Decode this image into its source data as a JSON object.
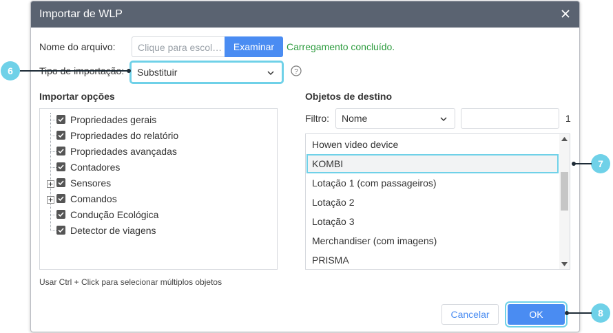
{
  "dialog": {
    "title": "Importar de WLP",
    "file_label": "Nome do arquivo:",
    "file_placeholder": "Clique para escol…",
    "browse_label": "Examinar",
    "status": "Carregamento concluído.",
    "import_type_label": "Tipo de importação:",
    "import_type_value": "Substituir",
    "import_options_title": "Importar opções",
    "options": [
      {
        "label": "Propriedades gerais",
        "checked": true,
        "expandable": false
      },
      {
        "label": "Propriedades do relatório",
        "checked": true,
        "expandable": false
      },
      {
        "label": "Propriedades avançadas",
        "checked": true,
        "expandable": false
      },
      {
        "label": "Contadores",
        "checked": true,
        "expandable": false
      },
      {
        "label": "Sensores",
        "checked": true,
        "expandable": true
      },
      {
        "label": "Comandos",
        "checked": true,
        "expandable": true
      },
      {
        "label": "Condução Ecológica",
        "checked": true,
        "expandable": false
      },
      {
        "label": "Detector de viagens",
        "checked": true,
        "expandable": false
      }
    ],
    "hint": "Usar Ctrl + Click para selecionar múltiplos objetos",
    "targets_title": "Objetos de destino",
    "filter_label": "Filtro:",
    "filter_value": "Nome",
    "filter_count": "1",
    "targets": [
      {
        "label": "Howen video device",
        "selected": false
      },
      {
        "label": "KOMBI",
        "selected": true
      },
      {
        "label": "Lotação 1 (com passageiros)",
        "selected": false
      },
      {
        "label": "Lotação 2",
        "selected": false
      },
      {
        "label": "Lotação 3",
        "selected": false
      },
      {
        "label": "Merchandiser (com imagens)",
        "selected": false
      },
      {
        "label": "PRISMA",
        "selected": false
      }
    ],
    "cancel_label": "Cancelar",
    "ok_label": "OK"
  },
  "callouts": {
    "c6": "6",
    "c7": "7",
    "c8": "8"
  },
  "colors": {
    "accent": "#4a8cf2",
    "success": "#2e9c3f",
    "highlight": "#6fd1e8",
    "titlebar": "#5a6371"
  }
}
